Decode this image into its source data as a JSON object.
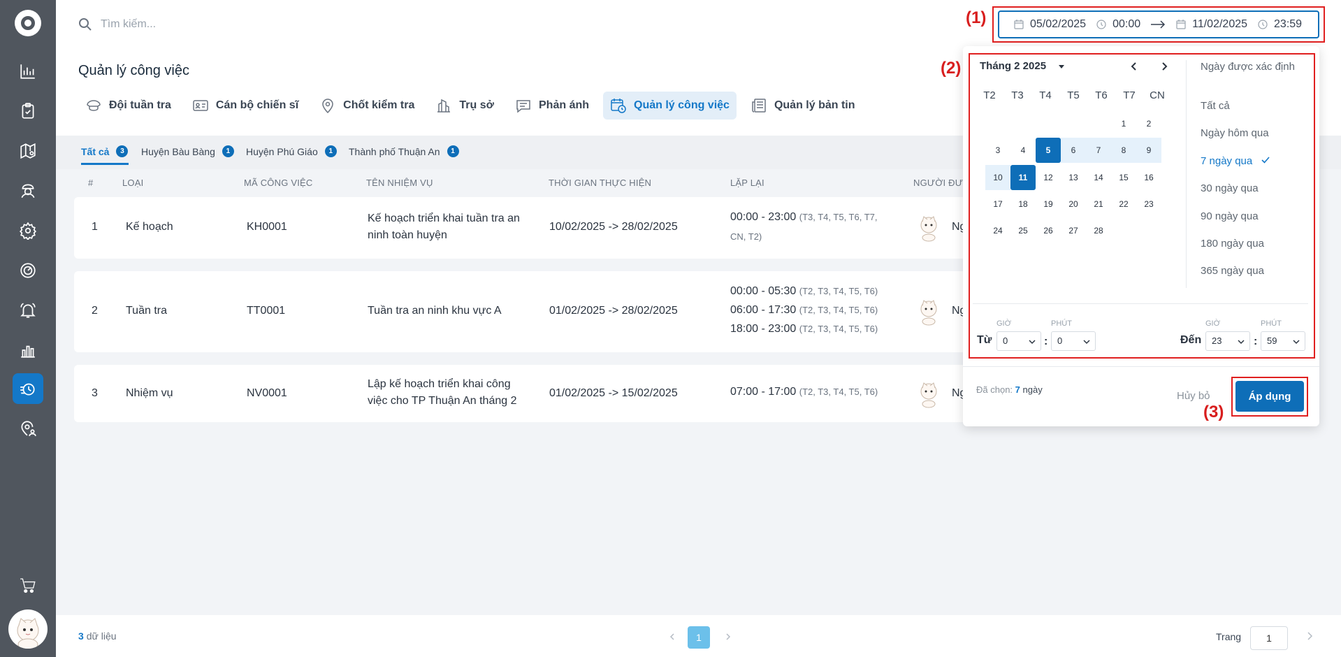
{
  "search": {
    "placeholder": "Tìm kiếm..."
  },
  "date_range": {
    "start_date": "05/02/2025",
    "start_time": "00:00",
    "end_date": "11/02/2025",
    "end_time": "23:59"
  },
  "annotations": {
    "a1": "(1)",
    "a2": "(2)",
    "a3": "(3)"
  },
  "page_title": "Quản lý công việc",
  "tabs": [
    {
      "label": "Đội tuần tra"
    },
    {
      "label": "Cán bộ chiến sĩ"
    },
    {
      "label": "Chốt kiểm tra"
    },
    {
      "label": "Trụ sở"
    },
    {
      "label": "Phản ánh"
    },
    {
      "label": "Quản lý công việc"
    },
    {
      "label": "Quản lý bản tin"
    }
  ],
  "subtabs": [
    {
      "label": "Tất cả",
      "count": "3"
    },
    {
      "label": "Huyện Bàu Bàng",
      "count": "1"
    },
    {
      "label": "Huyện Phú Giáo",
      "count": "1"
    },
    {
      "label": "Thành phố Thuận An",
      "count": "1"
    }
  ],
  "table": {
    "headers": [
      "#",
      "Loại",
      "Mã công việc",
      "Tên nhiệm vụ",
      "Thời gian thực hiện",
      "Lặp lại",
      "Người đượ"
    ],
    "rows": [
      {
        "num": "1",
        "type": "Kế hoạch",
        "code": "KH0001",
        "name1": "Kế hoạch triển khai tuần tra an",
        "name2": "ninh toàn huyện",
        "period": "10/02/2025 -> 28/02/2025",
        "r1": "00:00 - 23:00",
        "r1d": "(T3, T4, T5, T6, T7,",
        "r1d2": "CN, T2)",
        "person": "Ng"
      },
      {
        "num": "2",
        "type": "Tuần tra",
        "code": "TT0001",
        "name1": "Tuần tra an ninh khu vực A",
        "period": "01/02/2025 -> 28/02/2025",
        "r1": "00:00 - 05:30",
        "r1d": "(T2, T3, T4, T5, T6)",
        "r2": "06:00 - 17:30",
        "r2d": "(T2, T3, T4, T5, T6)",
        "r3": "18:00 - 23:00",
        "r3d": "(T2, T3, T4, T5, T6)",
        "person": "Ng"
      },
      {
        "num": "3",
        "type": "Nhiệm vụ",
        "code": "NV0001",
        "name1": "Lập kế hoạch triển khai công",
        "name2": "việc cho TP Thuận An tháng 2",
        "period": "01/02/2025 -> 15/02/2025",
        "r1": "07:00 - 17:00",
        "r1d": "(T2, T3, T4, T5, T6)",
        "person": "Ng"
      }
    ]
  },
  "footer": {
    "count": "3",
    "count_label": "dữ liệu",
    "page": "1",
    "page_label": "Trang",
    "page_input": "1"
  },
  "calendar": {
    "month_label": "Tháng 2 2025",
    "weekdays": [
      "T2",
      "T3",
      "T4",
      "T5",
      "T6",
      "T7",
      "CN"
    ],
    "presets": [
      "Ngày được xác định",
      "Tất cả",
      "Ngày hôm qua",
      "7 ngày qua",
      "30 ngày qua",
      "90 ngày qua",
      "180 ngày qua",
      "365 ngày qua"
    ],
    "active_preset": "7 ngày qua",
    "from_label": "Từ",
    "to_label": "Đến",
    "hour_label": "GIỜ",
    "minute_label": "PHÚT",
    "from_hour": "0",
    "from_minute": "0",
    "to_hour": "23",
    "to_minute": "59",
    "chosen_prefix": "Đã chọn:",
    "chosen_days": "7",
    "chosen_suffix": "ngày",
    "cancel_label": "Hủy bỏ",
    "apply_label": "Áp dụng"
  },
  "colors": {
    "accent": "#0e6eb8",
    "sidebar": "#50565e",
    "annotation": "#e02020"
  }
}
